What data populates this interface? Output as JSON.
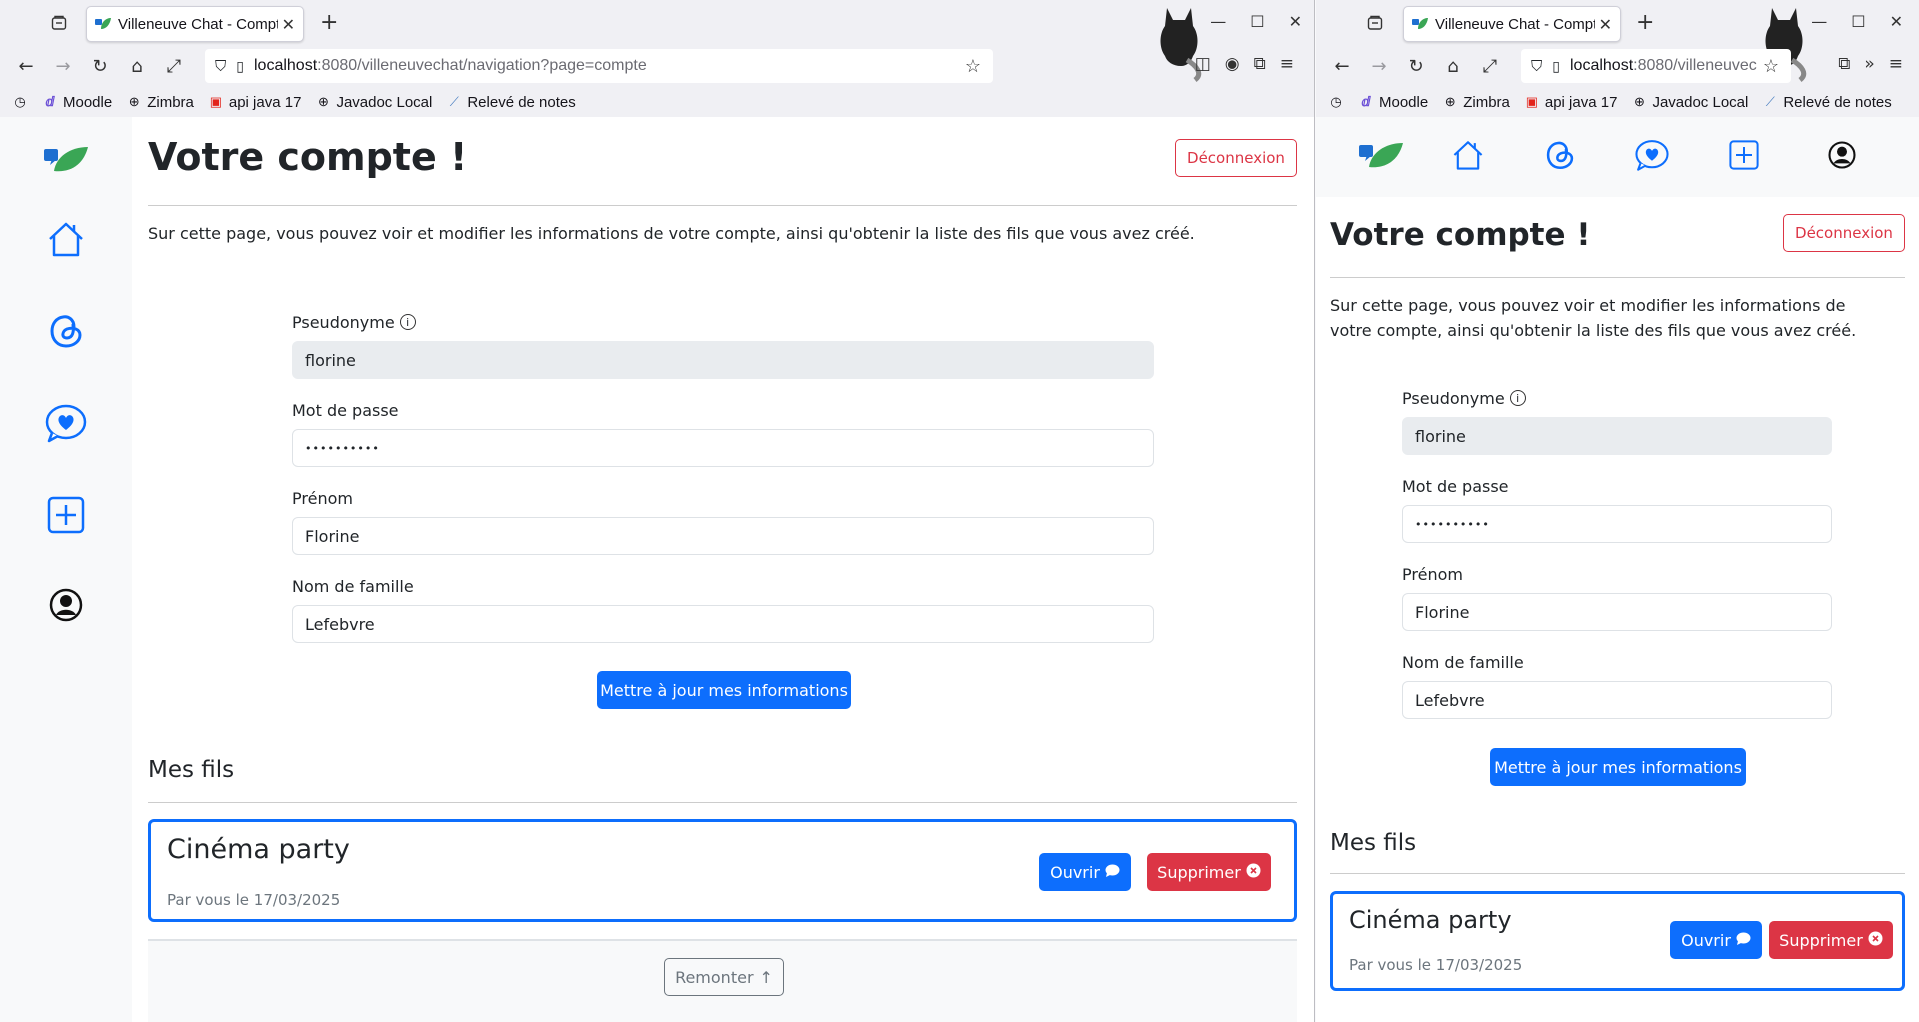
{
  "browser": {
    "tab_title": "Villeneuve Chat - Compte",
    "tab_title_short": "Villeneuve Chat - Compt",
    "url_host": "localhost",
    "url_path": ":8080/villeneuvechat/navigation?page=compte",
    "url_path_short": ":8080/villeneuvec",
    "bookmarks": [
      "Moodle",
      "Zimbra",
      "api java 17",
      "Javadoc Local",
      "Relevé de notes"
    ]
  },
  "page": {
    "title": "Votre compte !",
    "logout_label": "Déconnexion",
    "intro": "Sur cette page, vous pouvez voir et modifier les informations de votre compte, ainsi qu'obtenir la liste des fils que vous avez créé.",
    "form": {
      "pseudo_label": "Pseudonyme",
      "pseudo_value": "florine",
      "password_label": "Mot de passe",
      "password_value": "••••••••••",
      "firstname_label": "Prénom",
      "firstname_value": "Florine",
      "lastname_label": "Nom de famille",
      "lastname_value": "Lefebvre",
      "submit_label": "Mettre à jour mes informations"
    },
    "threads_heading": "Mes fils",
    "threads": [
      {
        "title": "Cinéma party",
        "meta": "Par vous le 17/03/2025",
        "open_label": "Ouvrir",
        "delete_label": "Supprimer"
      }
    ],
    "back_to_top_label": "Remonter"
  },
  "colors": {
    "primary": "#0d6efd",
    "danger": "#dc3545",
    "sidebar_bg": "#f8f9fa",
    "secondary": "#6c757d"
  }
}
